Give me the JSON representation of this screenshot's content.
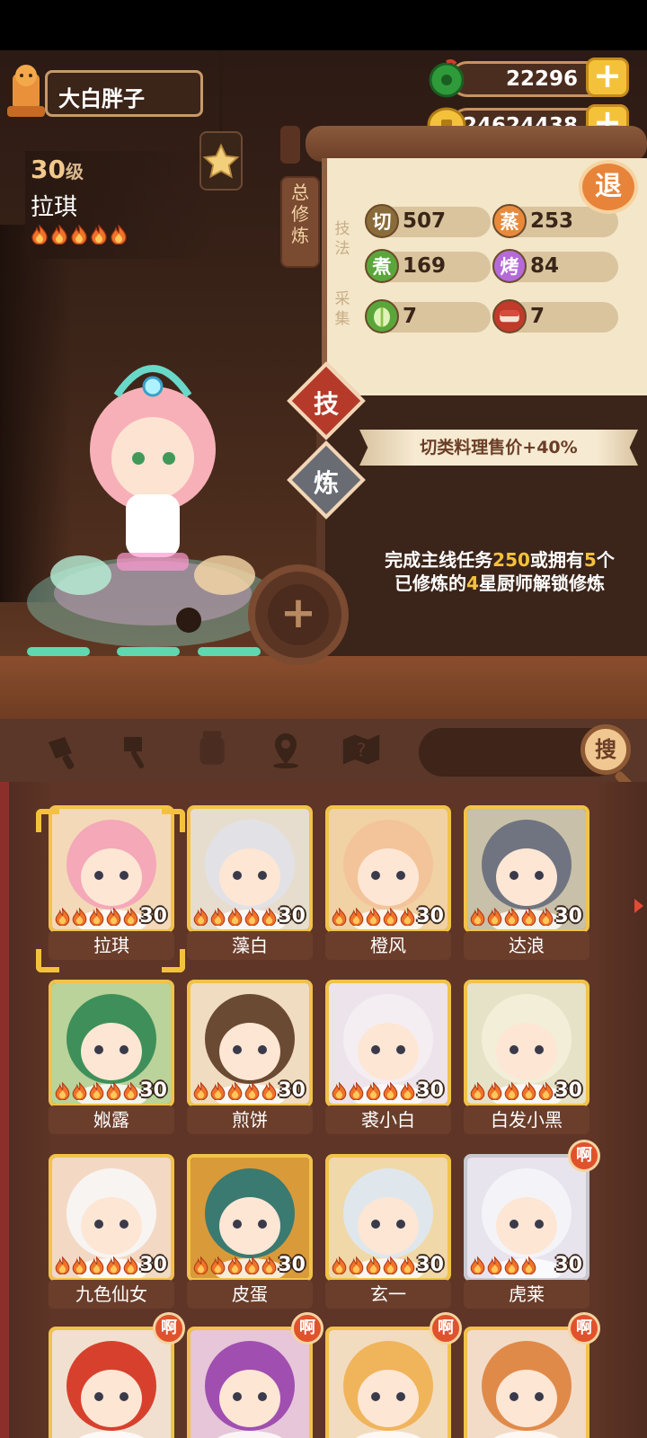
{
  "player": {
    "name": "大白胖子"
  },
  "currency": {
    "jade": "22296",
    "coins": "24624438"
  },
  "chef": {
    "level": "30",
    "level_unit": "级",
    "name": "拉琪",
    "stars": 5
  },
  "training_panel": {
    "tab_label": [
      "总",
      "修",
      "炼"
    ],
    "skill_label": [
      "技",
      "法"
    ],
    "gather_label": [
      "采",
      "集"
    ],
    "skills": [
      {
        "icon": "切",
        "value": "507",
        "color": "#8a6b3a"
      },
      {
        "icon": "蒸",
        "value": "253",
        "color": "#e88a3a"
      },
      {
        "icon": "煮",
        "value": "169",
        "color": "#5aa63a"
      },
      {
        "icon": "烤",
        "value": "84",
        "color": "#b46ad8"
      }
    ],
    "gather": [
      {
        "icon": "vegetable-icon",
        "value": "7"
      },
      {
        "icon": "meat-icon",
        "value": "7"
      }
    ],
    "back_label": "退"
  },
  "side_buttons": {
    "skill": "技",
    "refine": "炼"
  },
  "bonus_text": "切类料理售价+40%",
  "unlock": {
    "prefix": "完成主线任务",
    "task_num": "250",
    "mid": "或拥有",
    "count": "5",
    "mid2": "个",
    "line2a": "已修炼的",
    "star": "4",
    "line2b": "星厨师解锁修炼"
  },
  "toolbar": {
    "search_label": "搜"
  },
  "chefs": [
    {
      "name": "拉琪",
      "level": "30",
      "flames": 5,
      "bg": "#f3d9b8",
      "hair": "#f4a8b8",
      "tag": ""
    },
    {
      "name": "藻白",
      "level": "30",
      "flames": 5,
      "bg": "#e7ddcf",
      "hair": "#e2e2e6",
      "tag": ""
    },
    {
      "name": "橙风",
      "level": "30",
      "flames": 5,
      "bg": "#f1d2a4",
      "hair": "#f3c49a",
      "tag": ""
    },
    {
      "name": "达浪",
      "level": "30",
      "flames": 5,
      "bg": "#c8c0a8",
      "hair": "#6f7480",
      "tag": ""
    },
    {
      "name": "娰露",
      "level": "30",
      "flames": 5,
      "bg": "#b9d39a",
      "hair": "#3f8f5a",
      "tag": ""
    },
    {
      "name": "煎饼",
      "level": "30",
      "flames": 5,
      "bg": "#f0dcc0",
      "hair": "#6b4a33",
      "tag": ""
    },
    {
      "name": "裘小白",
      "level": "30",
      "flames": 5,
      "bg": "#ece4ea",
      "hair": "#f4eef2",
      "tag": ""
    },
    {
      "name": "白发小黑",
      "level": "30",
      "flames": 5,
      "bg": "#e6e2c8",
      "hair": "#f3eed8",
      "tag": ""
    },
    {
      "name": "九色仙女",
      "level": "30",
      "flames": 5,
      "bg": "#f3d9c4",
      "hair": "#f8f4f2",
      "tag": ""
    },
    {
      "name": "皮蛋",
      "level": "30",
      "flames": 5,
      "bg": "#d99a3a",
      "hair": "#3a7a70",
      "tag": ""
    },
    {
      "name": "玄一",
      "level": "30",
      "flames": 5,
      "bg": "#f1d8a8",
      "hair": "#dfe7ec",
      "tag": ""
    },
    {
      "name": "虎莱",
      "level": "30",
      "flames": 4,
      "bg": "#e7e4ee",
      "hair": "#f4f4f8",
      "tag": "啊"
    },
    {
      "name": "",
      "level": "",
      "flames": 0,
      "bg": "#f1e0d0",
      "hair": "#d8402e",
      "tag": "啊"
    },
    {
      "name": "",
      "level": "",
      "flames": 0,
      "bg": "#e6c6d8",
      "hair": "#a04fb0",
      "tag": "啊"
    },
    {
      "name": "",
      "level": "",
      "flames": 0,
      "bg": "#f2dcc0",
      "hair": "#f0b45a",
      "tag": "啊"
    },
    {
      "name": "",
      "level": "",
      "flames": 0,
      "bg": "#f2dcc8",
      "hair": "#e08a4a",
      "tag": "啊"
    }
  ]
}
